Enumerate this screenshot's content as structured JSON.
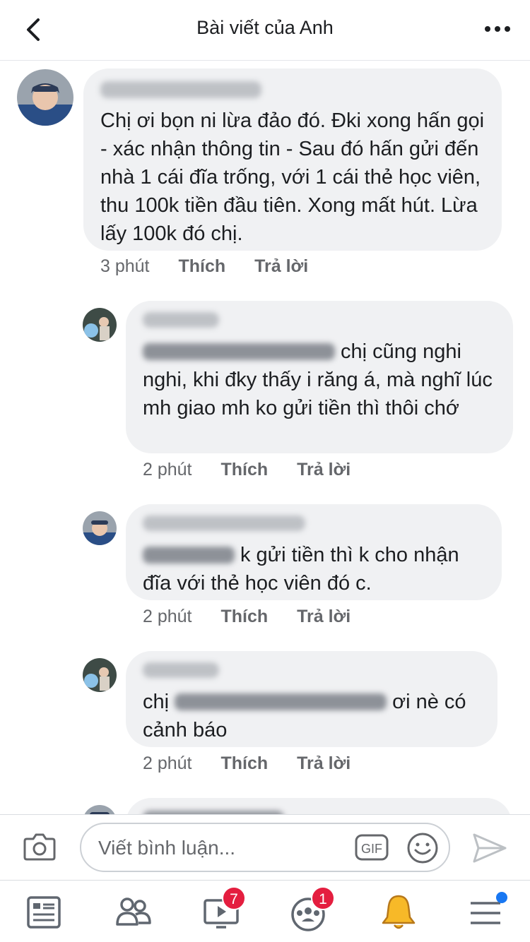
{
  "header": {
    "title": "Bài viết của Anh"
  },
  "comments": [
    {
      "text": "Chị ơi bọn ni lừa đảo đó. Đki xong hấn gọi - xác nhận thông tin - Sau đó hấn gửi đến nhà 1 cái đĩa trống, với 1 cái thẻ học viên, thu 100k tiền đầu tiên. Xong mất hút. Lừa lấy 100k đó chị.",
      "time": "3 phút",
      "like": "Thích",
      "reply": "Trả lời"
    },
    {
      "text_after_mention": "chị cũng nghi nghi, khi đky thấy i răng á, mà nghĩ lúc mh giao mh ko gửi tiền thì thôi chớ",
      "time": "2 phút",
      "like": "Thích",
      "reply": "Trả lời"
    },
    {
      "text_after_mention": "k gửi tiền thì k cho nhận đĩa với thẻ học viên đó c.",
      "time": "2 phút",
      "like": "Thích",
      "reply": "Trả lời"
    },
    {
      "text_before_mention": "chị",
      "text_after_mention": "ơi nè có cảnh báo",
      "time": "2 phút",
      "like": "Thích",
      "reply": "Trả lời"
    }
  ],
  "composer": {
    "placeholder": "Viết bình luận...",
    "gif_label": "GIF"
  },
  "nav": {
    "items": [
      {
        "icon": "news-feed-icon"
      },
      {
        "icon": "friends-icon"
      },
      {
        "icon": "watch-icon",
        "badge": "7"
      },
      {
        "icon": "groups-icon",
        "badge": "1"
      },
      {
        "icon": "notifications-bell-icon"
      },
      {
        "icon": "menu-icon",
        "dot": true
      }
    ]
  },
  "colors": {
    "bubble": "#f0f1f3",
    "meta": "#65676b",
    "badge": "#e41e3f",
    "accent": "#1877f2",
    "bell": "#f7b928"
  }
}
